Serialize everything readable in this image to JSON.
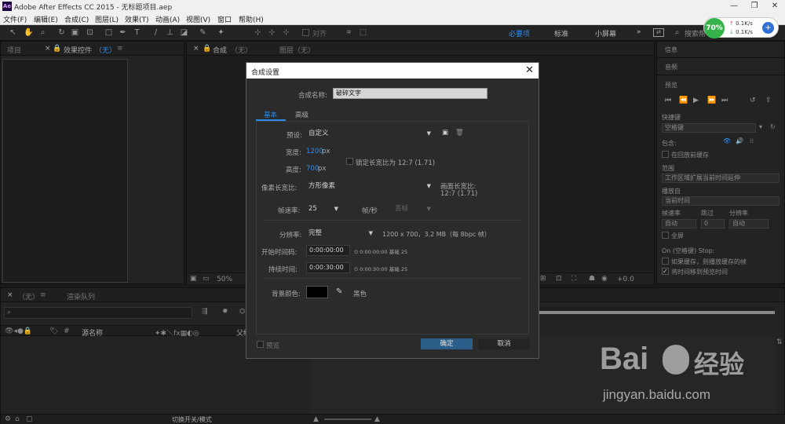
{
  "window": {
    "title": "Adobe After Effects CC 2015 - 无标题项目.aep",
    "logo": "Ae",
    "controls": [
      "—",
      "❐",
      "✕"
    ]
  },
  "menu": [
    "文件(F)",
    "编辑(E)",
    "合成(C)",
    "图层(L)",
    "效果(T)",
    "动画(A)",
    "视图(V)",
    "窗口",
    "帮助(H)"
  ],
  "toolbar": {
    "align_label": "对齐",
    "workspaces": [
      "必要项",
      "标准",
      "小屏幕"
    ],
    "more": "»",
    "search_placeholder": "搜索帮"
  },
  "net": {
    "percent": "70%",
    "up": "0.1K/s",
    "down": "0.1K/s",
    "plus": "+"
  },
  "panels": {
    "project_tab": "项目",
    "effects_tab": "效果控件",
    "effects_none": "（无）",
    "comp_tab": "合成",
    "comp_none": "（无）",
    "layer_tab": "图层（无）",
    "zoom": "50%",
    "offset": "+0.0",
    "timeline_tab": "（无）",
    "render_tab": "渲染队列",
    "source_name": "源名称",
    "parent": "父级",
    "switch_mode": "切换开关/模式"
  },
  "right": {
    "info": "信息",
    "audio": "音频",
    "preview": "预览",
    "shortcut": "快捷键",
    "shortcut_val": "空格键",
    "include": "包含:",
    "cache_before": "在回放前缓存",
    "range": "范围",
    "range_val": "工作区域扩展当前时间延伸",
    "play_from": "播放自",
    "play_from_val": "当前时间",
    "fps": "帧速率",
    "skip": "跳过",
    "resolution": "分辨率",
    "fps_val": "自动",
    "skip_val": "0",
    "res_val": "自动",
    "fullscreen": "全屏",
    "on_stop": "On (空格键) Stop:",
    "if_cache": "如果缓存，则播放缓存的帧",
    "move_time": "将时间移到预览时间"
  },
  "dialog": {
    "title": "合成设置",
    "close": "✕",
    "name_label": "合成名称:",
    "name_value": "破碎文字",
    "tabs": [
      "基本",
      "高级"
    ],
    "preset_label": "预设:",
    "preset_value": "自定义",
    "width_label": "宽度:",
    "width_value": "1200",
    "height_label": "高度:",
    "height_value": "700",
    "px": "px",
    "lock_ratio": "锁定长宽比为 12:7 (1.71)",
    "par_label": "像素长宽比:",
    "par_value": "方形像素",
    "frame_aspect_label": "画面长宽比:",
    "frame_aspect_value": "12:7 (1.71)",
    "fps_label": "帧速率:",
    "fps_value": "25",
    "fps_unit": "帧/秒",
    "drop_frame": "丢帧",
    "res_label": "分辨率:",
    "res_value": "完整",
    "res_info": "1200 x 700，3.2 MB（每 8bpc 帧）",
    "start_label": "开始时间码:",
    "start_value": "0:00:00:00",
    "start_info": "0:00:00:00",
    "start_base": "基础 25",
    "dur_label": "持续时间:",
    "dur_value": "0:00:30:00",
    "dur_info": "0:00:30:00",
    "dur_base": "基础 25",
    "bg_label": "背景颜色:",
    "bg_name": "黑色",
    "bg_color": "#000000",
    "preview": "预览",
    "ok": "确定",
    "cancel": "取消"
  },
  "watermark": {
    "brand": "Bai",
    "brand2": "经验",
    "url": "jingyan.baidu.com"
  },
  "colors": {
    "accent": "#2d8ceb",
    "ok_bg": "#2b5f8a"
  }
}
